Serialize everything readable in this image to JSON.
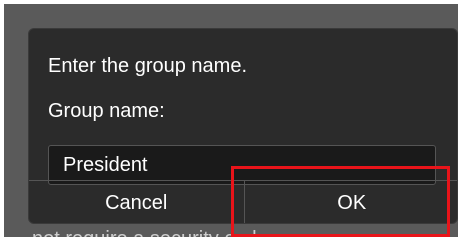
{
  "dialog": {
    "message": "Enter the group name.",
    "field_label": "Group name:",
    "input_value": "President",
    "cancel_label": "Cancel",
    "ok_label": "OK"
  },
  "background_text": "not require a security code",
  "colors": {
    "highlight": "#e8141a",
    "dialog_bg": "#2b2b2b",
    "screen_bg": "#5a5a5a"
  }
}
